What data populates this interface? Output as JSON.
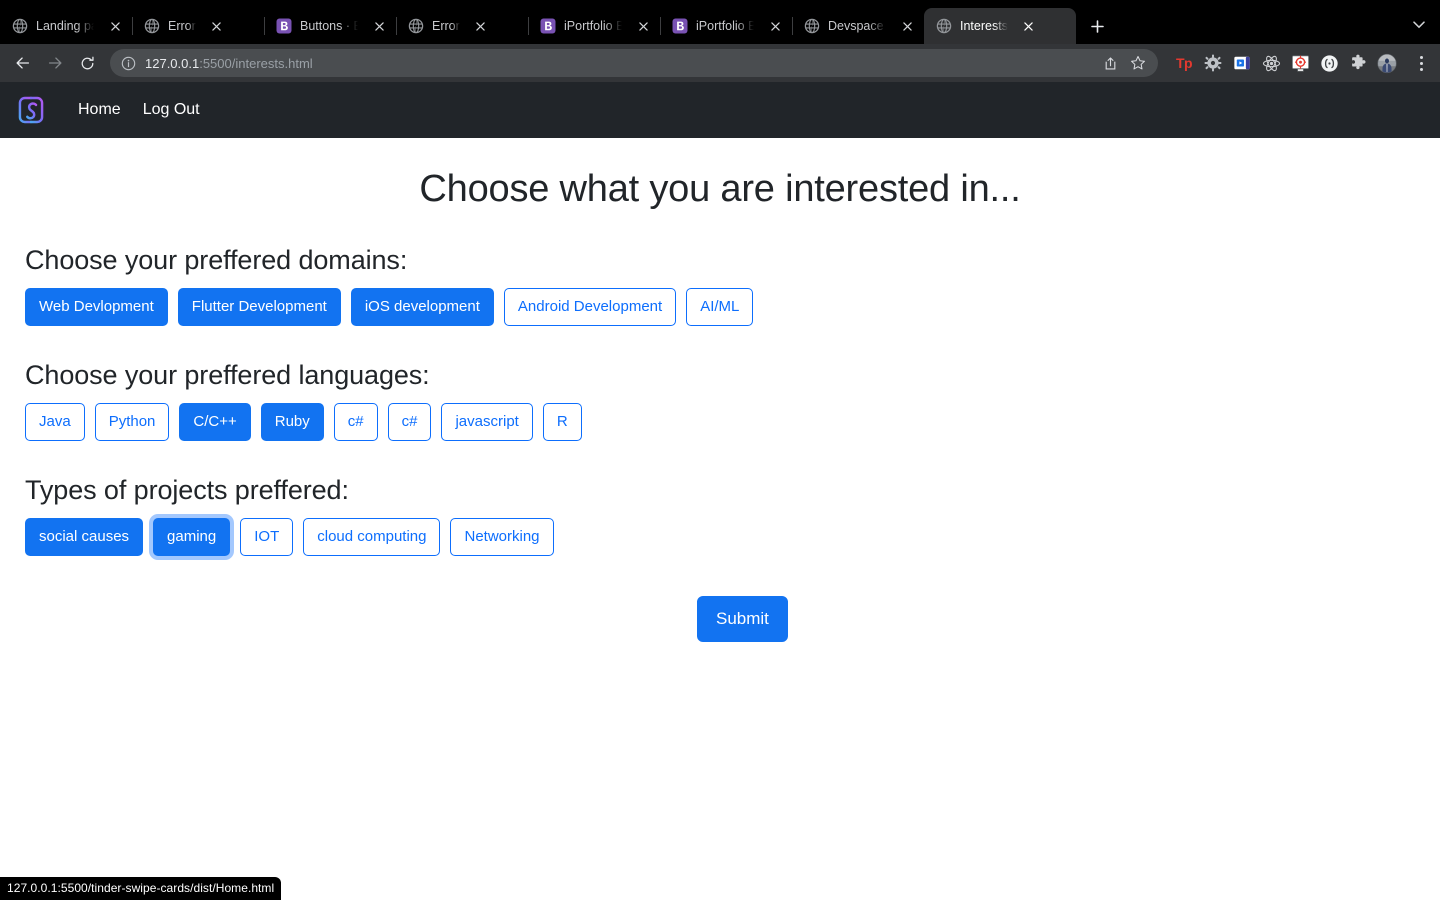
{
  "browser": {
    "tabs": [
      {
        "title": "Landing page",
        "favicon": "globe-icon",
        "active": false
      },
      {
        "title": "Error",
        "favicon": "globe-icon",
        "active": false
      },
      {
        "title": "Buttons · Bootstrap",
        "favicon": "bootstrap-icon",
        "active": false
      },
      {
        "title": "Error",
        "favicon": "globe-icon",
        "active": false
      },
      {
        "title": "iPortfolio Bootstrap",
        "favicon": "bootstrap-icon",
        "active": false
      },
      {
        "title": "iPortfolio Bootstrap",
        "favicon": "bootstrap-icon",
        "active": false
      },
      {
        "title": "Devspace swipe cards",
        "favicon": "globe-icon",
        "active": false
      },
      {
        "title": "Interests",
        "favicon": "globe-icon",
        "active": true
      }
    ],
    "new_tab_label": "+",
    "tab_search_label": "tab-search",
    "toolbar": {
      "back_label": "Back",
      "forward_label": "Forward",
      "reload_label": "Reload",
      "site_info_label": "View site information",
      "url_host": "127.0.0.1",
      "url_path": ":5500/interests.html",
      "url_full": "127.0.0.1:5500/interests.html",
      "share_label": "Share this page",
      "bookmark_label": "Bookmark this tab",
      "extensions": [
        "toggl-track-icon",
        "gear-icon",
        "video-recorder-icon",
        "react-devtools-icon",
        "screenshot-icon",
        "code-braces-icon",
        "extensions-puzzle-icon",
        "profile-avatar-icon"
      ],
      "menu_label": "Customize and control Google Chrome"
    },
    "statusbar_url": "127.0.0.1:5500/tinder-swipe-cards/dist/Home.html"
  },
  "site": {
    "nav": {
      "brand_label": "devspace-logo",
      "links": [
        {
          "label": "Home"
        },
        {
          "label": "Log Out"
        }
      ]
    },
    "page_title": "Choose what you are interested in...",
    "sections": [
      {
        "heading": "Choose your preffered domains:",
        "name": "domains",
        "options": [
          {
            "label": "Web Devlopment",
            "selected": true,
            "focused": false
          },
          {
            "label": "Flutter Development",
            "selected": true,
            "focused": false
          },
          {
            "label": "iOS development",
            "selected": true,
            "focused": false
          },
          {
            "label": "Android Development",
            "selected": false,
            "focused": false
          },
          {
            "label": "AI/ML",
            "selected": false,
            "focused": false
          }
        ]
      },
      {
        "heading": "Choose your preffered languages:",
        "name": "languages",
        "options": [
          {
            "label": "Java",
            "selected": false,
            "focused": false
          },
          {
            "label": "Python",
            "selected": false,
            "focused": false
          },
          {
            "label": "C/C++",
            "selected": true,
            "focused": false
          },
          {
            "label": "Ruby",
            "selected": true,
            "focused": false
          },
          {
            "label": "c#",
            "selected": false,
            "focused": false
          },
          {
            "label": "c#",
            "selected": false,
            "focused": false
          },
          {
            "label": "javascript",
            "selected": false,
            "focused": false
          },
          {
            "label": "R",
            "selected": false,
            "focused": false
          }
        ]
      },
      {
        "heading": "Types of projects preffered:",
        "name": "project-types",
        "options": [
          {
            "label": "social causes",
            "selected": true,
            "focused": false
          },
          {
            "label": "gaming",
            "selected": true,
            "focused": true
          },
          {
            "label": "IOT",
            "selected": false,
            "focused": false
          },
          {
            "label": "cloud computing",
            "selected": false,
            "focused": false
          },
          {
            "label": "Networking",
            "selected": false,
            "focused": false
          }
        ]
      }
    ],
    "submit_label": "Submit"
  },
  "colors": {
    "accent_blue": "#1273f1",
    "outline_blue": "#0d6efd",
    "navbar_dark": "#212529",
    "chrome_tabstrip": "#000000",
    "chrome_toolbar": "#333538",
    "active_tab": "#2f3032"
  }
}
